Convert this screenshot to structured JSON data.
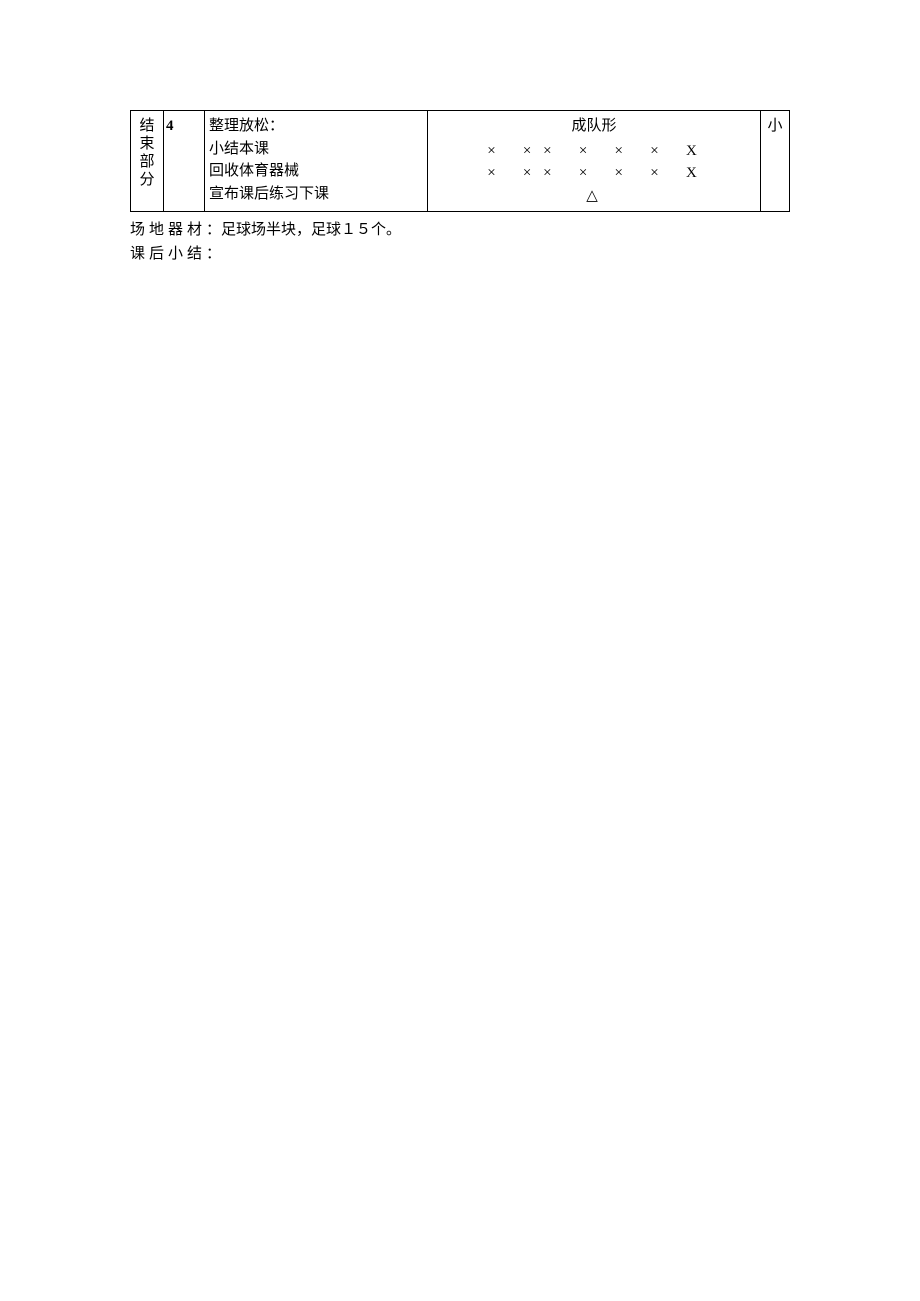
{
  "table": {
    "section_label": "结束部分",
    "time": "4",
    "activities": {
      "l1": "整理放松：",
      "l2": "小结本课",
      "l3": "回收体育器械",
      "l4": "宣布课后练习下课"
    },
    "formation": {
      "title": "成队形",
      "row1": "×   × ×   ×   ×   ×   X",
      "row2": "×   × ×   ×   ×   ×   X",
      "teacher": "△"
    },
    "note": "小"
  },
  "footer": {
    "equipment_label": "场地器材",
    "equipment_sep": "：",
    "equipment_value": "足球场半块，足球１５个。",
    "summary_label": "课后小结",
    "summary_sep": "："
  }
}
